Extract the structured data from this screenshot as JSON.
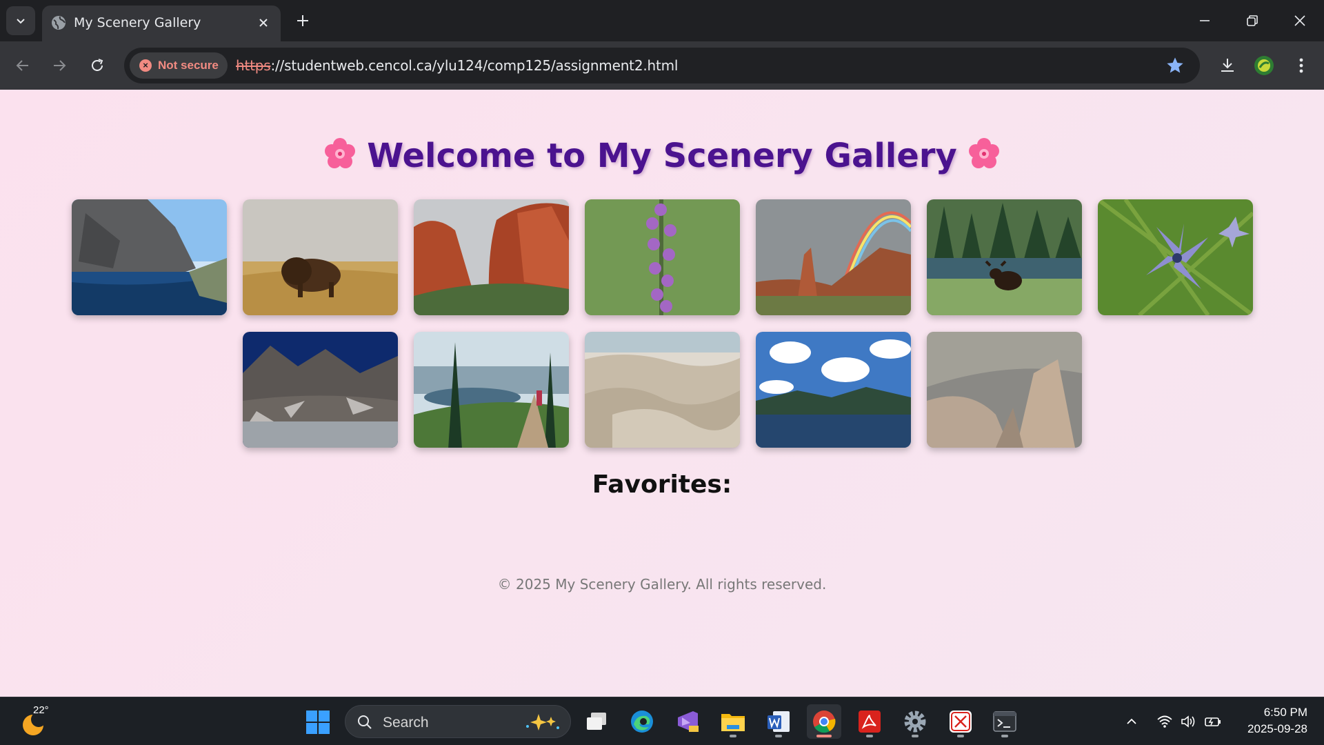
{
  "browser": {
    "tab_title": "My Scenery Gallery",
    "security_label": "Not secure",
    "url_scheme": "https",
    "url_rest": "://studentweb.cencol.ca/ylu124/comp125/assignment2.html"
  },
  "page": {
    "heading": "Welcome to My Scenery Gallery",
    "favorites_label": "Favorites:",
    "footer": "© 2025 My Scenery Gallery. All rights reserved."
  },
  "gallery": {
    "row1": [
      "lake-cliff",
      "bison-prairie",
      "red-rocks",
      "purple-orchid",
      "rainbow-canyon",
      "moose-forest",
      "blue-wildflower"
    ],
    "row2": [
      "snowy-mountain-lake",
      "hiker-trail",
      "badlands",
      "cloudy-lake",
      "rocky-cliff"
    ]
  },
  "taskbar": {
    "temperature": "22°",
    "search_placeholder": "Search",
    "time": "6:50 PM",
    "date": "2025-09-28"
  },
  "colors": {
    "heading": "#4b138f",
    "page_bg": "#fbe3ee",
    "chrome_bg": "#35363a",
    "taskbar_bg": "#1c2025",
    "warning": "#f28b82"
  }
}
